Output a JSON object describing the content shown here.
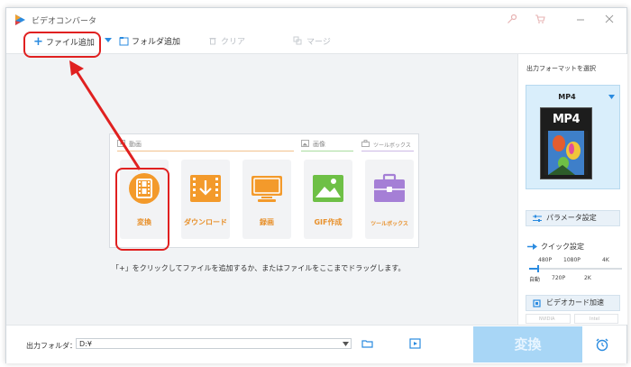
{
  "app": {
    "title": "ビデオコンバータ"
  },
  "titlebar": {
    "key_icon": "key-icon",
    "cart_icon": "cart-icon",
    "minimize_icon": "minimize-icon",
    "close_icon": "close-icon"
  },
  "toolbar": {
    "add_file_label": "ファイル追加",
    "add_folder_label": "フォルダ追加",
    "clear_label": "クリア",
    "merge_label": "マージ"
  },
  "sections": {
    "video": "動画",
    "image": "画像",
    "toolbox": "ツールボックス"
  },
  "tiles": [
    {
      "label": "変換",
      "icon": "film-icon"
    },
    {
      "label": "ダウンロード",
      "icon": "download-icon"
    },
    {
      "label": "録画",
      "icon": "screen-record-icon"
    },
    {
      "label": "GIF作成",
      "icon": "gif-image-icon"
    },
    {
      "label": "ツールボックス",
      "icon": "toolbox-icon"
    }
  ],
  "hint": "「+」をクリックしてファイルを追加するか、またはファイルをここまでドラッグします。",
  "right_panel": {
    "title": "出力フォーマットを選択",
    "format": "MP4",
    "format_icon_text": "MP4",
    "parameter_label": "パラメータ設定",
    "quick_label": "クイック設定",
    "quality_top": [
      "480P",
      "1080P",
      "4K"
    ],
    "quality_bottom": [
      "自動",
      "720P",
      "2K"
    ],
    "gpu_label": "ビデオカード加速",
    "nvidia_label": "NVIDIA",
    "intel_label": "Intel"
  },
  "bottom": {
    "output_label": "出力フォルダ：",
    "output_path": "D:¥",
    "convert_label": "変換"
  },
  "colors": {
    "accent": "#2a8be0",
    "orange": "#e8902a",
    "highlight": "#e02020"
  }
}
